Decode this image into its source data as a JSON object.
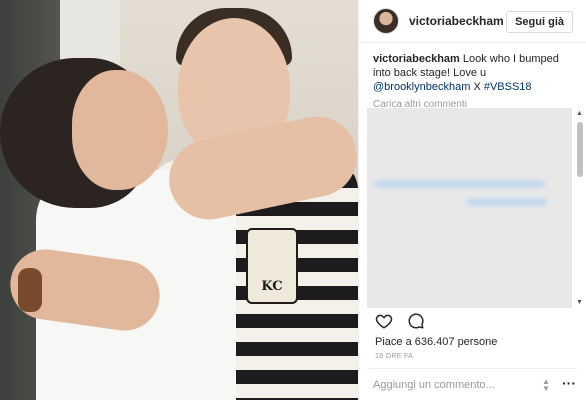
{
  "post": {
    "username": "victoriabeckham",
    "follow_label": "Segui già",
    "caption_user": "victoriabeckham",
    "caption_text_1": " Look who I bumped into back stage! Love u ",
    "caption_mention": "@brooklynbeckham",
    "caption_text_2": " X ",
    "caption_hashtag": "#VBSS18",
    "load_more": "Carica altri commenti",
    "likes": "Piace a 636.407 persone",
    "time": "18 ORE FA",
    "comment_placeholder": "Aggiungi un commento...",
    "patch_text": "KC"
  },
  "icons": {
    "verified": "verified-badge-icon",
    "like": "heart-icon",
    "comment": "comment-bubble-icon",
    "more": "more-options-icon"
  },
  "colors": {
    "verified": "#3897f0",
    "link": "#003569",
    "muted": "#999999"
  }
}
